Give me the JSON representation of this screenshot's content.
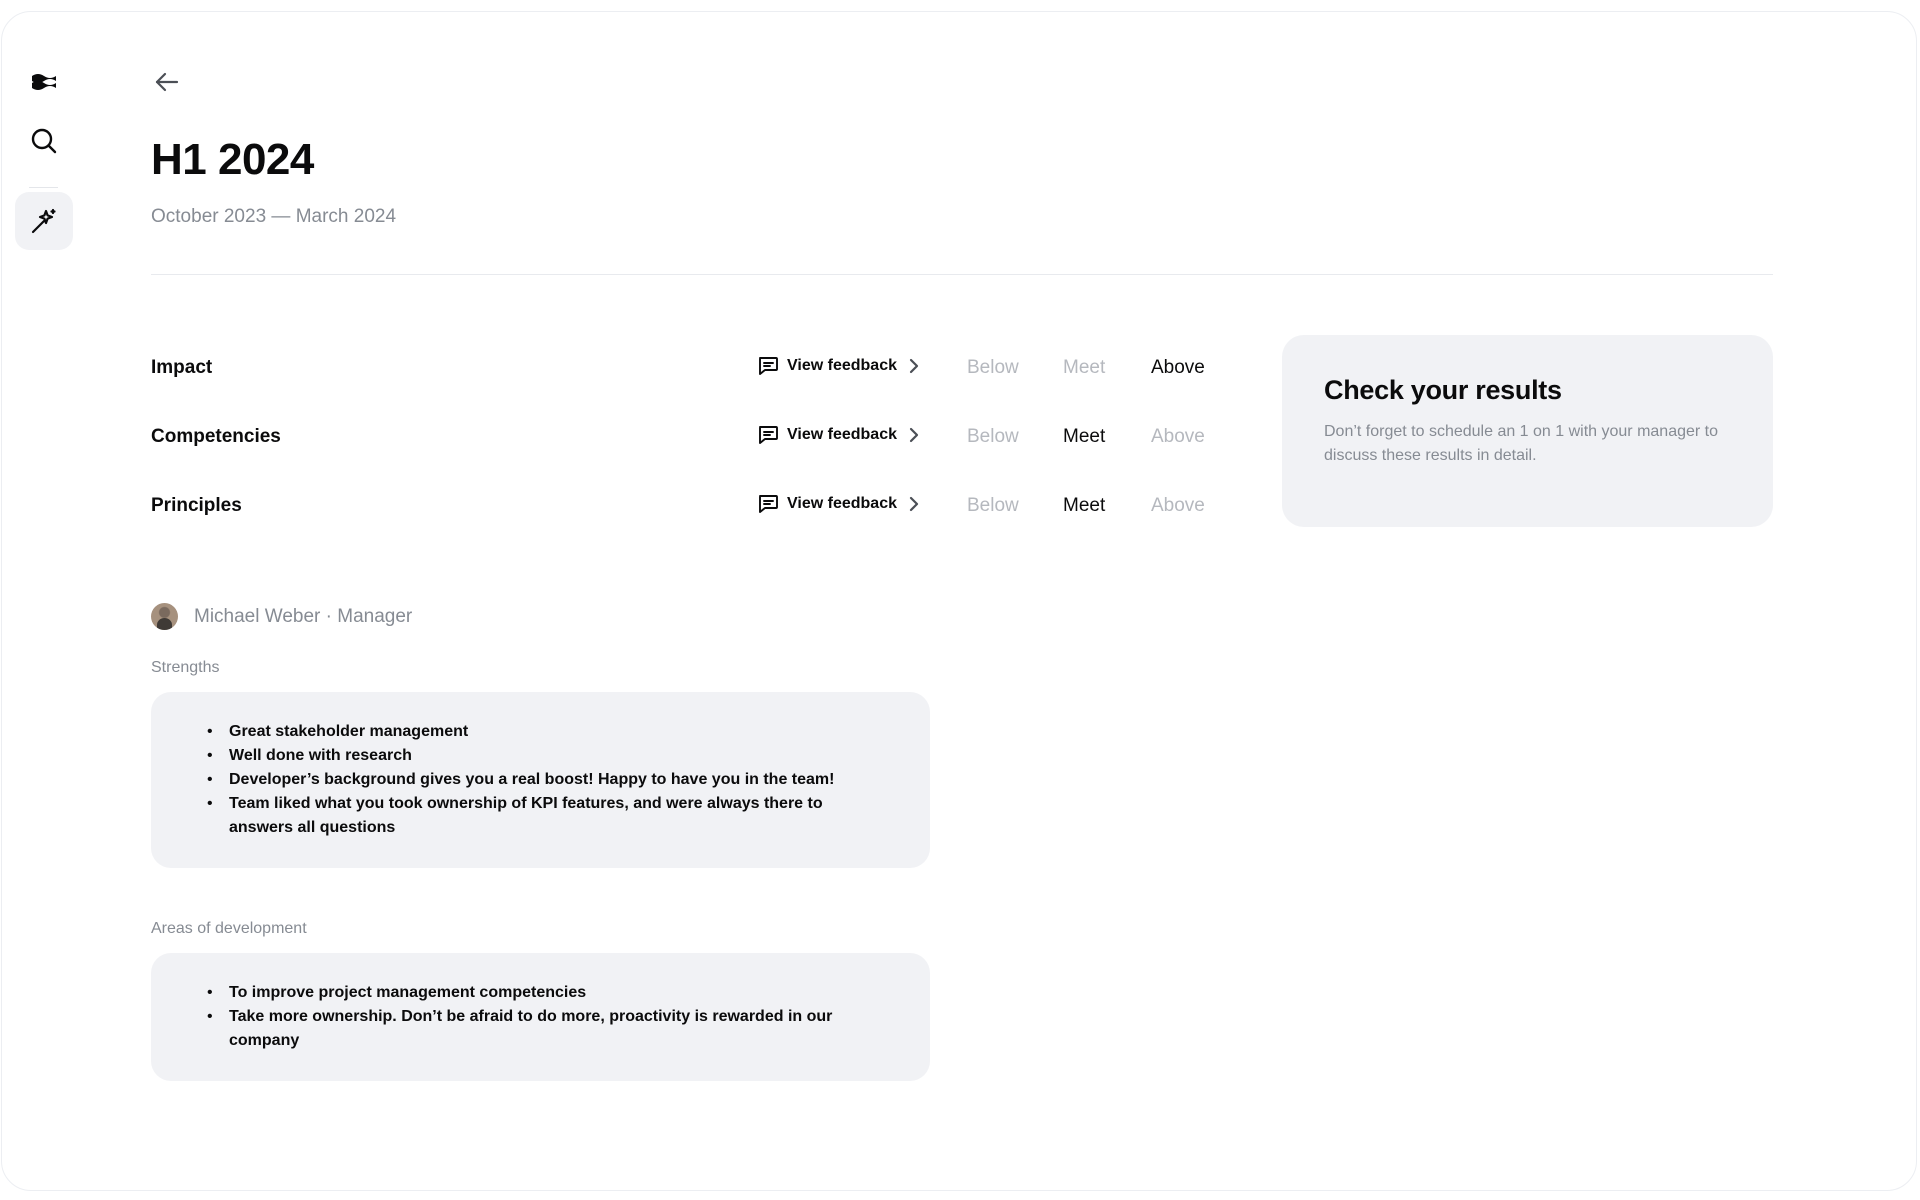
{
  "sidebar": {
    "items": [
      {
        "icon": "logo-icon"
      },
      {
        "icon": "search-icon"
      },
      {
        "icon": "magic-wand-icon",
        "active": true
      }
    ]
  },
  "header": {
    "back_icon": "arrow-left-icon",
    "title": "H1 2024",
    "subtitle": "October 2023 — March 2024"
  },
  "ratings": {
    "options": [
      "Below",
      "Meet",
      "Above"
    ],
    "feedback_label": "View feedback",
    "rows": [
      {
        "name": "Impact",
        "selected": "Above"
      },
      {
        "name": "Competencies",
        "selected": "Meet"
      },
      {
        "name": "Principles",
        "selected": "Meet"
      }
    ]
  },
  "results_card": {
    "title": "Check your results",
    "text": "Don’t forget to schedule an 1 on 1 with your manager to discuss these results in detail."
  },
  "reviewer": {
    "name": "Michael Weber · Manager"
  },
  "strengths": {
    "label": "Strengths",
    "items": [
      "Great stakeholder management",
      "Well done with research",
      "Developer’s background gives you a real boost! Happy to have you in the team!",
      "Team liked what you took ownership of KPI features, and were always there to answers all questions"
    ]
  },
  "development": {
    "label": "Areas of development",
    "items": [
      "To improve project management competencies",
      "Take more ownership. Don’t be afraid to do more, proactivity is rewarded in our company"
    ]
  },
  "colors": {
    "text": "#0b0b0c",
    "muted": "#868b93",
    "inactive": "#b5b8be",
    "card_bg": "#f1f2f5"
  }
}
